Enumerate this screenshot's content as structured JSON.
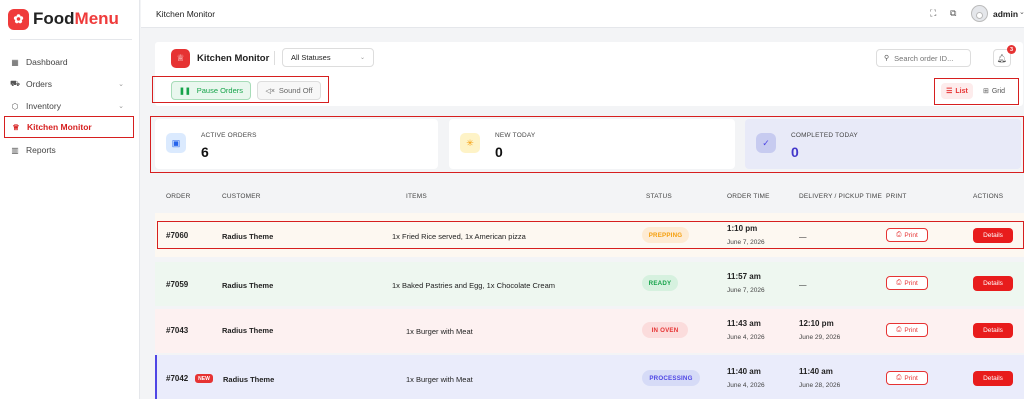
{
  "app": {
    "brand_a": "Food",
    "brand_b": "Menu"
  },
  "sidebar": {
    "items": [
      {
        "label": "Dashboard",
        "icon": "dashboard-icon"
      },
      {
        "label": "Orders",
        "icon": "cart-icon"
      },
      {
        "label": "Inventory",
        "icon": "box-icon"
      },
      {
        "label": "Kitchen Monitor",
        "icon": "chef-hat-icon",
        "active": true
      },
      {
        "label": "Reports",
        "icon": "bar-chart-icon"
      }
    ]
  },
  "topbar": {
    "title": "Kitchen Monitor",
    "user": "admin"
  },
  "panel": {
    "title": "Kitchen Monitor",
    "status_filter": "All Statuses",
    "search_placeholder": "Search order ID...",
    "notification_count": "3",
    "pause_label": "Pause Orders",
    "sound_label": "Sound Off",
    "view_list": "List",
    "view_grid": "Grid"
  },
  "stats": [
    {
      "label": "ACTIVE ORDERS",
      "value": "6",
      "color": "#2563eb",
      "icon": "clipboard-icon"
    },
    {
      "label": "NEW TODAY",
      "value": "0",
      "color": "#f59e0b",
      "icon": "spinner-icon"
    },
    {
      "label": "COMPLETED TODAY",
      "value": "0",
      "color": "#4f46e5",
      "icon": "check-circle-icon"
    }
  ],
  "table": {
    "columns": [
      "ORDER",
      "CUSTOMER",
      "ITEMS",
      "STATUS",
      "ORDER TIME",
      "DELIVERY / PICKUP TIME",
      "PRINT",
      "ACTIONS"
    ],
    "print_label": "Print",
    "details_label": "Details",
    "new_label": "NEW",
    "rows": [
      {
        "order": "#7060",
        "customer": "Radius Theme",
        "items": "1x Fried Rice served, 1x American pizza",
        "status": "PREPPING",
        "order_time": "1:10 pm",
        "order_date": "June 7, 2026",
        "delivery_time": "—",
        "delivery_date": ""
      },
      {
        "order": "#7059",
        "customer": "Radius Theme",
        "items": "1x Baked Pastries and Egg, 1x Chocolate Cream",
        "status": "READY",
        "order_time": "11:57 am",
        "order_date": "June 7, 2026",
        "delivery_time": "—",
        "delivery_date": ""
      },
      {
        "order": "#7043",
        "customer": "Radius Theme",
        "items": "1x Burger with Meat",
        "status": "IN OVEN",
        "order_time": "11:43 am",
        "order_date": "June 4, 2026",
        "delivery_time": "12:10 pm",
        "delivery_date": "June 29, 2026"
      },
      {
        "order": "#7042",
        "customer": "Radius Theme",
        "items": "1x Burger with Meat",
        "status": "PROCESSING",
        "order_time": "11:40 am",
        "order_date": "June 4, 2026",
        "delivery_time": "11:40 am",
        "delivery_date": "June 28, 2026",
        "is_new": true
      }
    ]
  }
}
